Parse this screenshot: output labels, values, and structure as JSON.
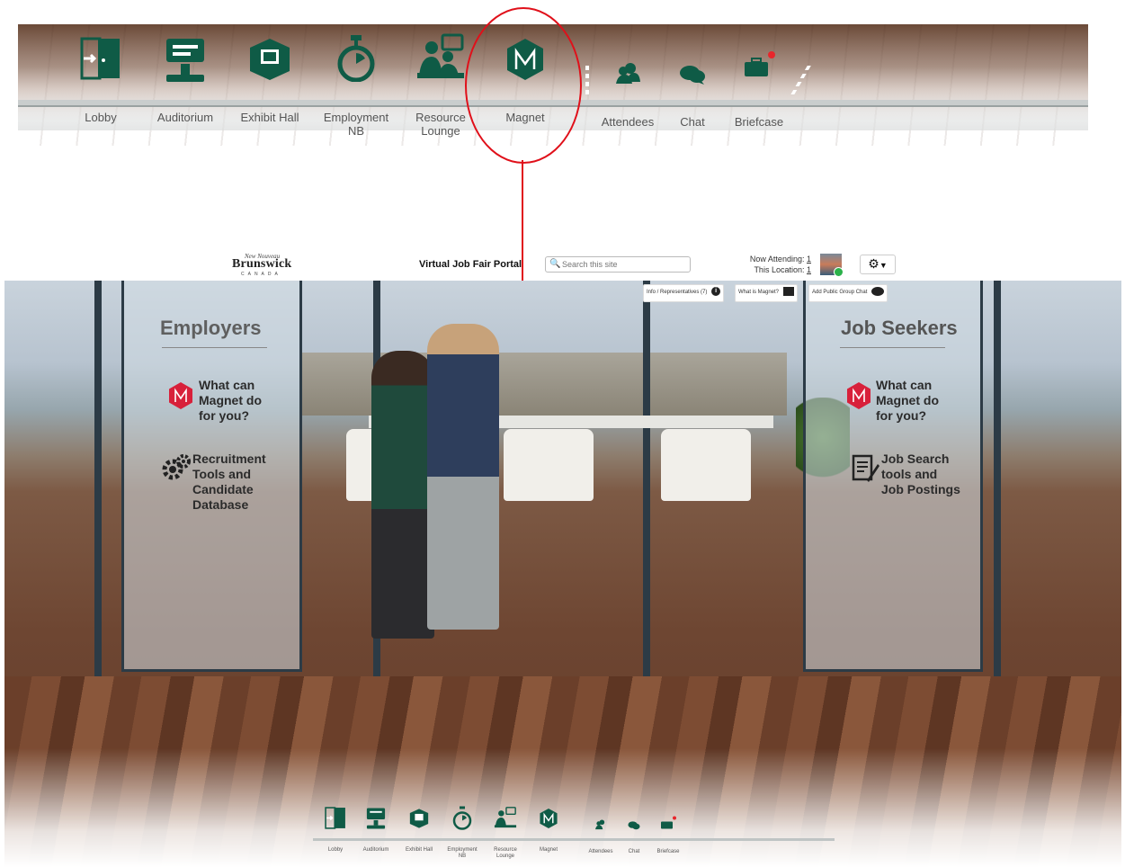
{
  "nav": {
    "items": [
      {
        "label": "Lobby",
        "icon": "lobby-door-icon"
      },
      {
        "label": "Auditorium",
        "icon": "auditorium-podium-icon"
      },
      {
        "label": "Exhibit Hall",
        "icon": "exhibit-hall-icon"
      },
      {
        "label": "Employment NB",
        "icon": "employment-stopwatch-icon"
      },
      {
        "label": "Resource Lounge",
        "icon": "resource-lounge-icon"
      },
      {
        "label": "Magnet",
        "icon": "magnet-hexagon-icon"
      },
      {
        "label": "Attendees",
        "icon": "attendees-icon"
      },
      {
        "label": "Chat",
        "icon": "chat-bubbles-icon"
      },
      {
        "label": "Briefcase",
        "icon": "briefcase-icon"
      }
    ],
    "zoom_labels": {
      "lobby": "Lobby",
      "auditorium": "Auditorium",
      "exhibit": "Exhibit Hall",
      "employment_1": "Employment",
      "employment_2": "NB",
      "resource_1": "Resource",
      "resource_2": "Lounge",
      "magnet": "Magnet",
      "attendees": "Attendees",
      "chat": "Chat",
      "briefcase": "Briefcase"
    },
    "briefcase_notification_color": "#e8262b"
  },
  "header": {
    "logo_top": "New Nouveau",
    "logo_brand": "Brunswick",
    "logo_country": "CANADA",
    "portal_title": "Virtual Job Fair Portal",
    "search_placeholder": "Search this site",
    "now_attending_label": "Now Attending:",
    "now_attending_count": "1",
    "this_location_label": "This Location:",
    "this_location_count": "1"
  },
  "toolbar": {
    "info_label": "Info / Representatives (7)",
    "what_is_magnet_label": "What is Magnet?",
    "add_group_chat_label": "Add Public Group Chat"
  },
  "employers": {
    "title": "Employers",
    "magnet_link": [
      "What can",
      "Magnet do",
      "for you?"
    ],
    "recruitment_link": [
      "Recruitment",
      "Tools and",
      "Candidate",
      "Database"
    ]
  },
  "job_seekers": {
    "title": "Job Seekers",
    "magnet_link": [
      "What can",
      "Magnet do",
      "for you?"
    ],
    "job_search_link": [
      "Job Search",
      "tools and",
      "Job Postings"
    ]
  },
  "colors": {
    "brand_green": "#0f5b46",
    "magnet_red": "#d8203a",
    "callout_red": "#e0101a"
  }
}
